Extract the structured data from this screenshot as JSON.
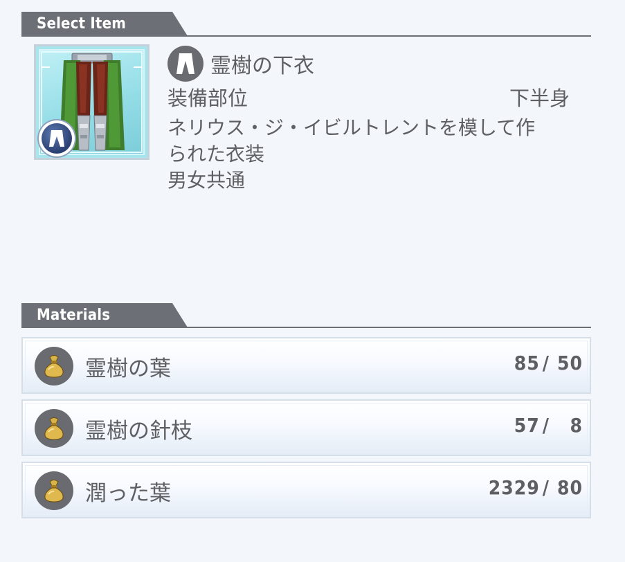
{
  "select_item": {
    "header": "Select Item",
    "item_name": "霊樹の下衣",
    "category_icon": "pants-icon",
    "slot_label": "装備部位",
    "slot_value": "下半身",
    "description": "ネリウス・ジ・イビルトレントを模して作\nられた衣装\n男女共通"
  },
  "materials": {
    "header": "Materials",
    "items": [
      {
        "icon": "money-bag-icon",
        "name": "霊樹の葉",
        "have": "85",
        "need": "50"
      },
      {
        "icon": "money-bag-icon",
        "name": "霊樹の針枝",
        "have": "57",
        "need": "8"
      },
      {
        "icon": "money-bag-icon",
        "name": "潤った葉",
        "have": "2329",
        "need": "80"
      }
    ]
  },
  "colors": {
    "background": "#f3f6fb",
    "header_tab": "#6c6f75",
    "text": "#5d5f63",
    "thumbnail_bg": "#a8e4ec",
    "icon_circle": "#696b70"
  }
}
